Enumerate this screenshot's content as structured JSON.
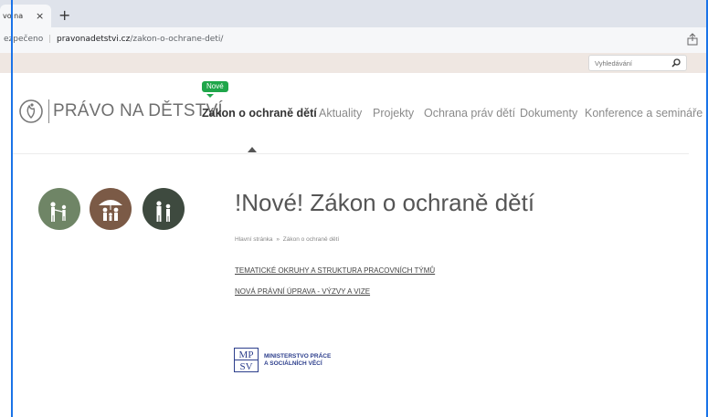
{
  "browser": {
    "tab_title": "vo na",
    "tab_close": "×",
    "new_tab": "+",
    "url_security": "ezpečeno",
    "url_separator": "|",
    "url_domain": "pravonadetstvi.cz",
    "url_path": "/zakon-o-ochrane-deti/"
  },
  "site": {
    "search_placeholder": "Vyhledávání",
    "logo_text": "PRÁVO NA DĚTSTVÍ",
    "nav_badge": "Nové",
    "nav": [
      {
        "label": "Zákon o ochraně dětí",
        "active": true
      },
      {
        "label": "Aktuality"
      },
      {
        "label": "Projekty"
      },
      {
        "label": "Ochrana práv dětí"
      },
      {
        "label": "Dokumenty"
      },
      {
        "label": "Konference a semináře"
      }
    ],
    "circles": [
      {
        "color": "#6f8566",
        "icon": "family-walking-icon"
      },
      {
        "color": "#7b5a46",
        "icon": "family-umbrella-icon"
      },
      {
        "color": "#3e4a3f",
        "icon": "parent-child-icon"
      }
    ]
  },
  "content": {
    "title": "!Nové! Zákon o ochraně dětí",
    "breadcrumb_home": "Hlavní stránka",
    "breadcrumb_sep": "»",
    "breadcrumb_current": "Zákon o ochraně dětí",
    "links": [
      "TEMATICKÉ OKRUHY A STRUKTURA PRACOVNÍCH TÝMŮ",
      "NOVÁ PRÁVNÍ ÚPRAVA - VÝZVY A VIZE"
    ],
    "ministry_line1": "MINISTERSTVO PRÁCE",
    "ministry_line2": "A SOCIÁLNÍCH VĚCÍ",
    "ministry_mark_top": "MP",
    "ministry_mark_bottom": "SV"
  }
}
